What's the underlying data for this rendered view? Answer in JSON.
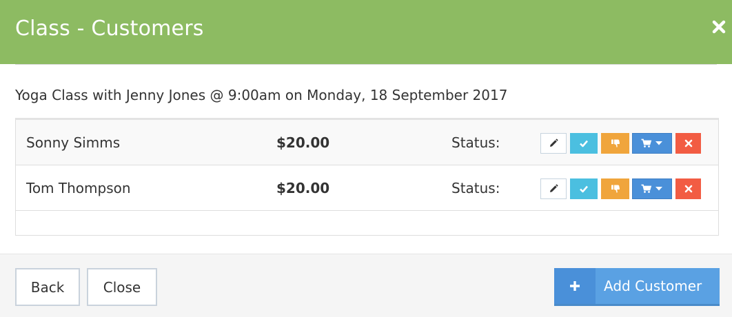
{
  "dialog": {
    "title": "Class - Customers",
    "close_icon": "close-icon"
  },
  "class_info": "Yoga Class with Jenny Jones @ 9:00am on Monday, 18 September 2017",
  "customers": [
    {
      "name": "Sonny Simms",
      "price": "$20.00",
      "status_label": "Status:"
    },
    {
      "name": "Tom Thompson",
      "price": "$20.00",
      "status_label": "Status:"
    }
  ],
  "row_actions": [
    "pencil-icon",
    "check-icon",
    "thumbs-down-icon",
    "cart-icon",
    "times-icon"
  ],
  "footer": {
    "back_label": "Back",
    "close_label": "Close",
    "add_label": "Add Customer"
  },
  "colors": {
    "header": "#8dbb62",
    "check": "#4bbfe0",
    "thumbs_down": "#f0a53c",
    "cart": "#4a90d9",
    "delete": "#f25c43",
    "add_button": "#5aa1e3"
  }
}
